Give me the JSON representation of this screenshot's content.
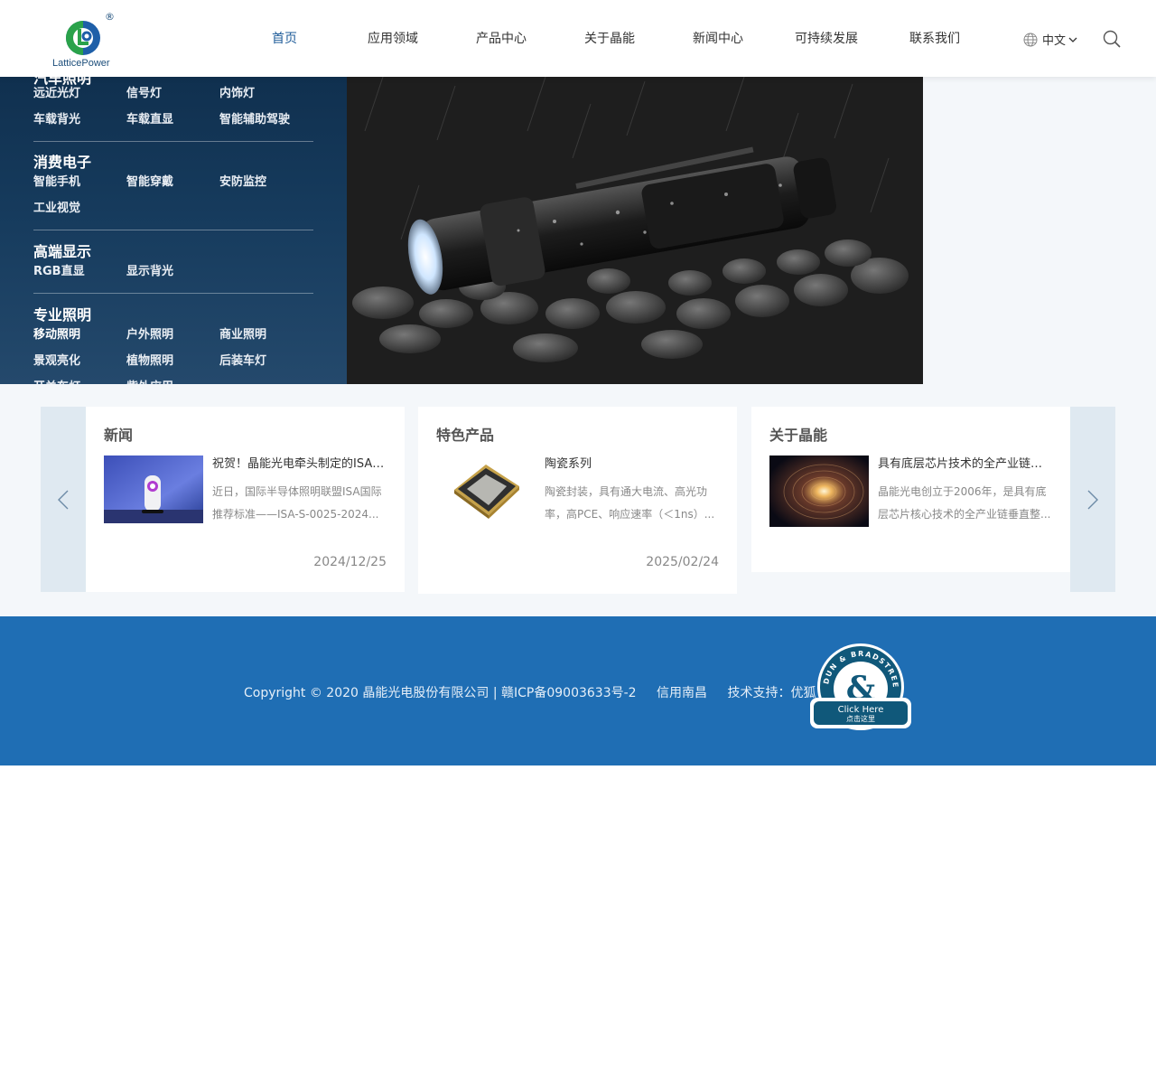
{
  "header": {
    "logo_text": "LatticePower",
    "logo_reg": "®",
    "nav": [
      "首页",
      "应用领域",
      "产品中心",
      "关于晶能",
      "新闻中心",
      "可持续发展",
      "联系我们"
    ],
    "active_index": 0,
    "language": "中文",
    "accent_color": "#1f5c99"
  },
  "menu": {
    "top_cut_title": "汽车照明",
    "groups": [
      {
        "title": "",
        "items": [
          "远近光灯",
          "信号灯",
          "内饰灯",
          "车载背光",
          "车载直显",
          "智能辅助驾驶"
        ]
      },
      {
        "title": "消费电子",
        "items": [
          "智能手机",
          "智能穿戴",
          "安防监控",
          "工业视觉"
        ]
      },
      {
        "title": "高端显示",
        "items": [
          "RGB直显",
          "显示背光"
        ]
      },
      {
        "title": "专业照明",
        "items": [
          "移动照明",
          "户外照明",
          "商业照明",
          "景观亮化",
          "植物照明",
          "后装车灯"
        ]
      }
    ],
    "bottom_cut_items": [
      "开关车灯",
      "紫外应用"
    ]
  },
  "cards": [
    {
      "title": "新闻",
      "headline": "祝贺！晶能光电牵头制定的ISA国际推荐标准正式发布",
      "summary": "近日，国际半导体照明联盟ISA国际推荐标准——ISA-S-0025-2024...",
      "date": "2024/12/25"
    },
    {
      "title": "特色产品",
      "headline": "陶瓷系列",
      "summary": "陶瓷封装，具有通大电流、高光功率，高PCE、响应速率（＜1ns）...",
      "date": "2025/02/24"
    },
    {
      "title": "关于晶能",
      "headline": "具有底层芯片技术的全产业链垂直整合的LED企业",
      "summary": "晶能光电创立于2006年，是具有底层芯片核心技术的全产业链垂直整...",
      "date": ""
    }
  ],
  "footer": {
    "copyright": "Copyright © 2020 晶能光电股份有限公司 | 赣ICP备09003633号-2",
    "credit": "信用南昌",
    "support": "技术支持：优狐",
    "badge_ring": "DUN & BRADSTREET",
    "badge_en": "Click Here",
    "badge_cn": "点击这里",
    "bg_color": "#1f6eb4"
  }
}
